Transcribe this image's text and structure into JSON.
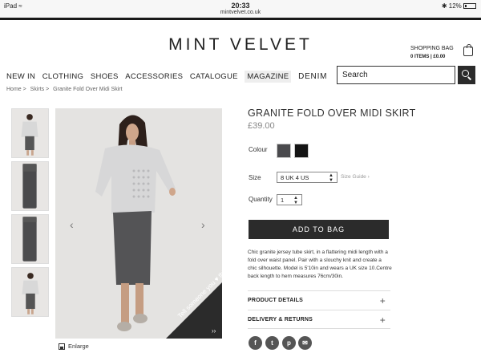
{
  "status": {
    "device": "iPad",
    "time": "20:33",
    "url": "mintvelvet.co.uk",
    "battery": "12%"
  },
  "header": {
    "logo": "MINT VELVET",
    "bag_title": "SHOPPING BAG",
    "bag_summary": "0 ITEMS | £0.00"
  },
  "nav": {
    "items": [
      "NEW IN",
      "CLOTHING",
      "SHOES",
      "ACCESSORIES",
      "CATALOGUE",
      "MAGAZINE",
      "DENIM"
    ]
  },
  "search": {
    "placeholder": "Search"
  },
  "breadcrumb": [
    "Home >",
    "Skirts >",
    "Granite Fold Over Midi Skirt"
  ],
  "gallery": {
    "tell_text": "Tell someone you ♥ this!",
    "enlarge_label": "Enlarge"
  },
  "product": {
    "title": "GRANITE FOLD OVER MIDI SKIRT",
    "price": "£39.00",
    "colour_label": "Colour",
    "swatch_colors": [
      "#4a4a4d",
      "#141414"
    ],
    "size_label": "Size",
    "size_value": "8 UK 4 US",
    "size_guide": "Size Guide ›",
    "quantity_label": "Quantity",
    "quantity_value": "1",
    "add_to_bag": "ADD TO BAG",
    "description": "Chic granite jersey tube skirt, in a flattering midi length with a fold over waist panel. Pair with a slouchy knit and create a chic silhouette. Model is 5'10in and wears a UK size 10.Centre back length to hem measures 76cm/30in.",
    "accordion": [
      "PRODUCT DETAILS",
      "DELIVERY & RETURNS"
    ]
  },
  "social_icons": [
    "facebook-icon",
    "twitter-icon",
    "pinterest-icon",
    "email-icon"
  ]
}
